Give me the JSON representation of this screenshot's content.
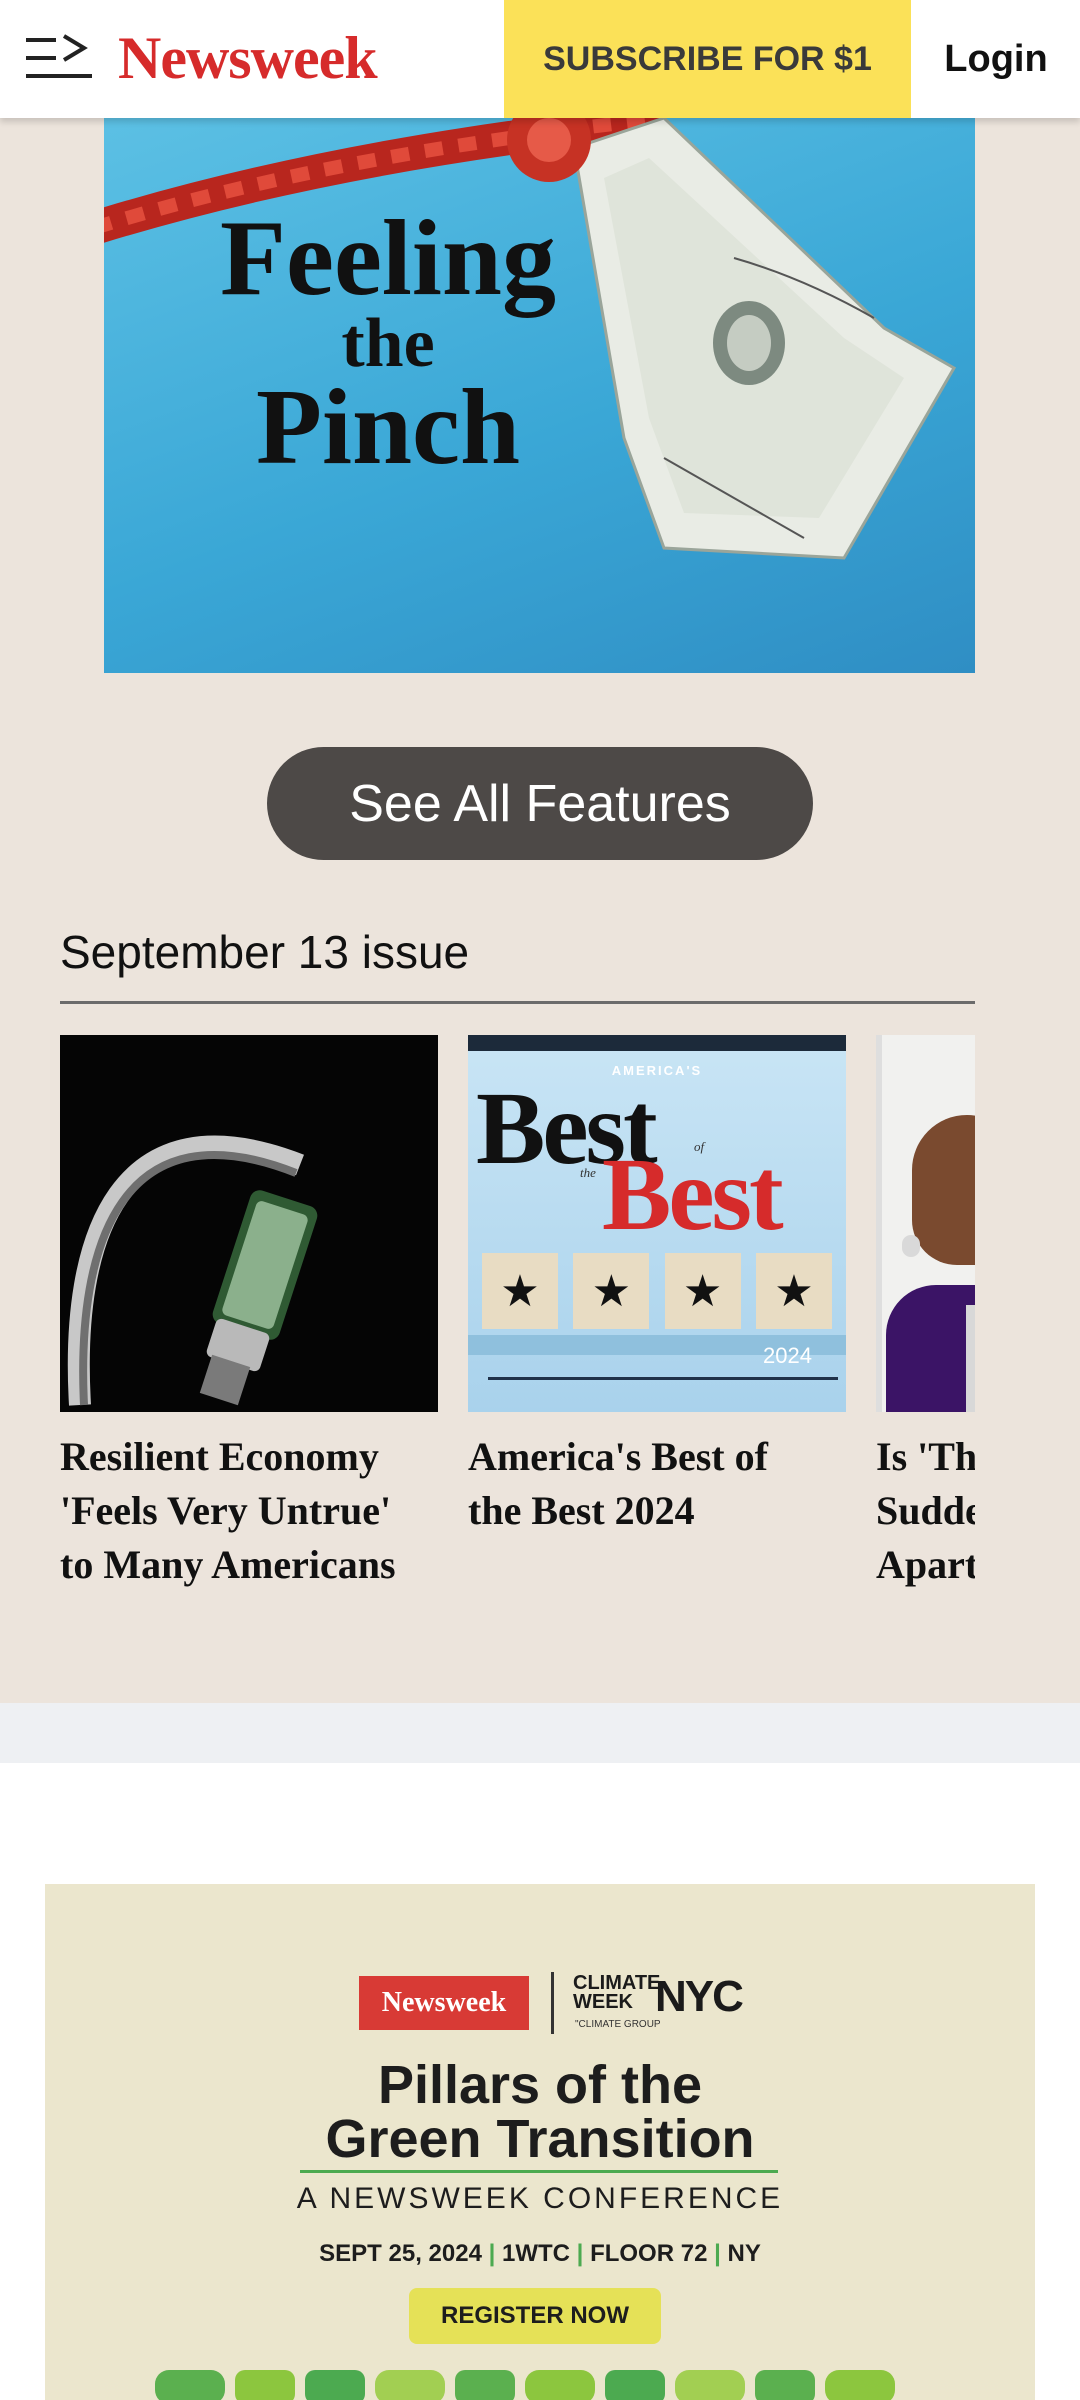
{
  "header": {
    "logo_text": "Newsweek",
    "subscribe_label": "SUBSCRIBE FOR $1",
    "login_label": "Login"
  },
  "feature": {
    "title_line1": "Feeling",
    "title_line2": "the",
    "title_line3": "Pinch",
    "see_all_label": "See All Features"
  },
  "issue": {
    "title": "September 13 issue",
    "cards": [
      {
        "title_lines": [
          "Resilient Economy",
          "'Feels Very Untrue'",
          "to Many Americans"
        ]
      },
      {
        "title_lines": [
          "America's Best of",
          "the Best 2024"
        ],
        "cover_kicker": "AMERICA'S",
        "cover_word1": "Best",
        "cover_of": "of",
        "cover_the": "the",
        "cover_word2": "Best",
        "cover_year": "2024"
      },
      {
        "title_lines": [
          "Is 'Th",
          "Sudde",
          "Apart"
        ]
      }
    ]
  },
  "ad": {
    "logo_text": "Newsweek",
    "climate_line1": "CLIMATE",
    "climate_line2": "WEEK",
    "nyc": "NYC",
    "climate_group": "\"CLIMATE GROUP",
    "headline_line1": "Pillars of the",
    "headline_line2": "Green Transition",
    "subtitle": "A NEWSWEEK CONFERENCE",
    "date": "SEPT 25, 2024",
    "venue": "1WTC",
    "floor": "FLOOR 72",
    "city": "NY",
    "register_label": "REGISTER NOW"
  },
  "colors": {
    "brand_red": "#d62b2b",
    "subscribe_yellow": "#fbe158",
    "page_bg": "#ece4dc",
    "button_dark": "#4d4947",
    "ad_green": "#4caa50"
  },
  "icons": {
    "menu": "menu-arrow-icon"
  }
}
